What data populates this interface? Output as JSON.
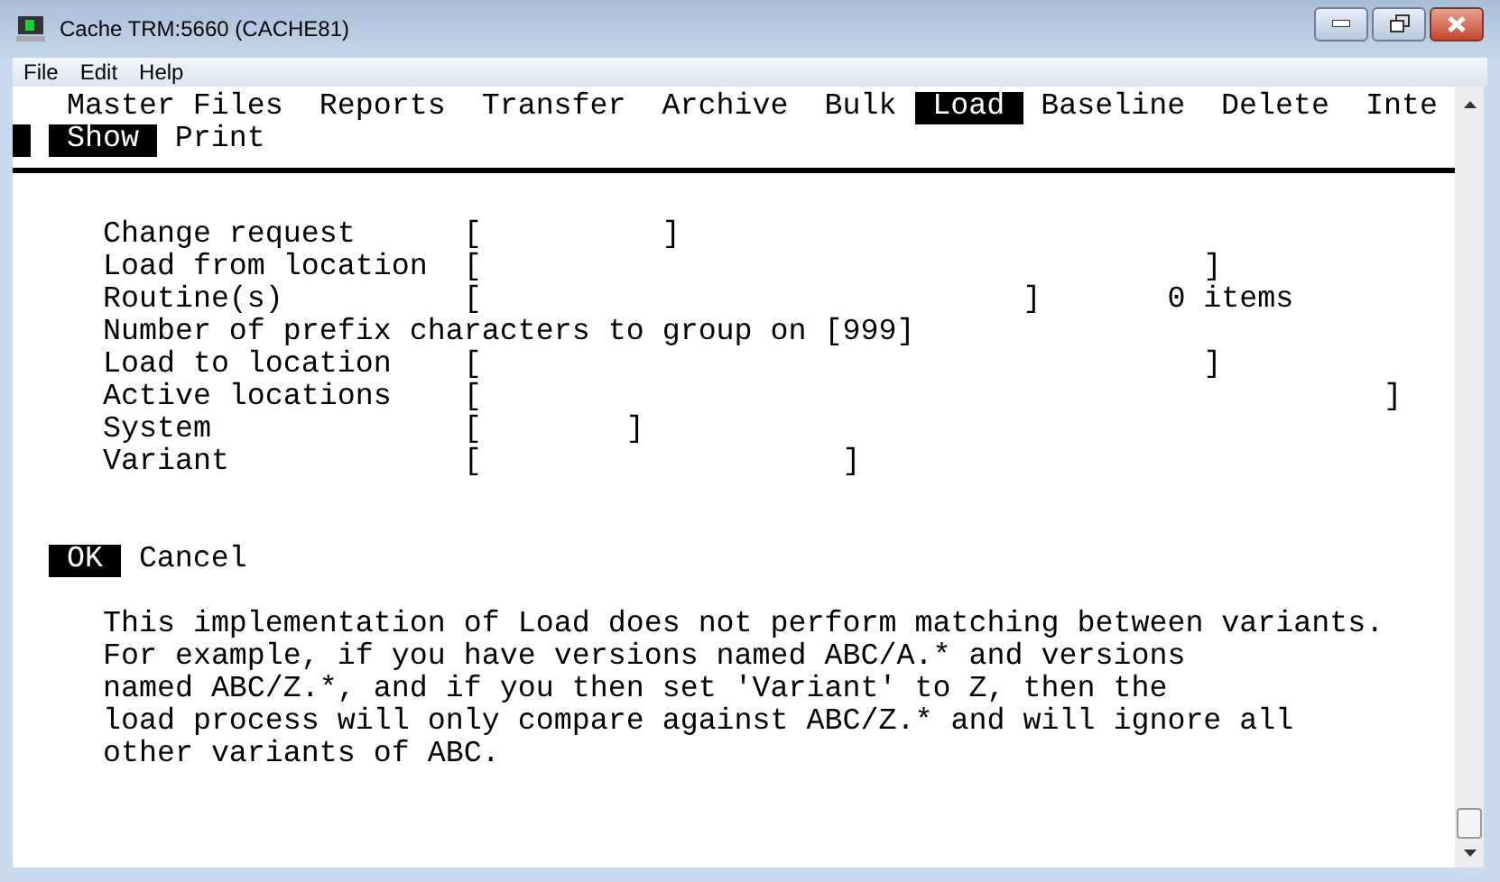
{
  "window": {
    "title": "Cache TRM:5660 (CACHE81)"
  },
  "menu_bar": [
    "File",
    "Edit",
    "Help"
  ],
  "terminal": {
    "menu": [
      {
        "label": "Master Files",
        "selected": false
      },
      {
        "label": "Reports",
        "selected": false
      },
      {
        "label": "Transfer",
        "selected": false
      },
      {
        "label": "Archive",
        "selected": false
      },
      {
        "label": "Bulk",
        "selected": false
      },
      {
        "label": "Load",
        "selected": true
      },
      {
        "label": "Baseline",
        "selected": false
      },
      {
        "label": "Delete",
        "selected": false
      },
      {
        "label": "Inte",
        "selected": false
      }
    ],
    "submenu": [
      {
        "label": "Show",
        "selected": true
      },
      {
        "label": "Print",
        "selected": false
      }
    ],
    "fields": [
      {
        "kind": "padded",
        "label": "Change request",
        "open": "[",
        "close": "]"
      },
      {
        "kind": "padded",
        "label": "Load from location",
        "open": "[",
        "close": "]"
      },
      {
        "kind": "padded",
        "label": "Routine(s)",
        "open": "[",
        "close": "]",
        "note": "0 items"
      },
      {
        "kind": "inline",
        "label": "Number of prefix characters to group on",
        "open": "[",
        "value": "999",
        "close": "]"
      },
      {
        "kind": "padded",
        "label": "Load to location",
        "open": "[",
        "close": "]"
      },
      {
        "kind": "padded",
        "label": "Active locations",
        "open": "[",
        "close": "]"
      },
      {
        "kind": "padded",
        "label": "System",
        "open": "[",
        "close": "]"
      },
      {
        "kind": "padded",
        "label": "Variant",
        "open": "[",
        "close": "]"
      }
    ],
    "buttons": [
      {
        "label": "OK",
        "selected": true
      },
      {
        "label": "Cancel",
        "selected": false
      }
    ],
    "help_lines": [
      "This implementation of Load does not perform matching between variants.",
      "For example, if you have versions named ABC/A.* and versions",
      "named ABC/Z.*, and if you then set 'Variant' to Z, then the",
      "load process will only compare against ABC/Z.* and will ignore all",
      "other variants of ABC."
    ]
  }
}
